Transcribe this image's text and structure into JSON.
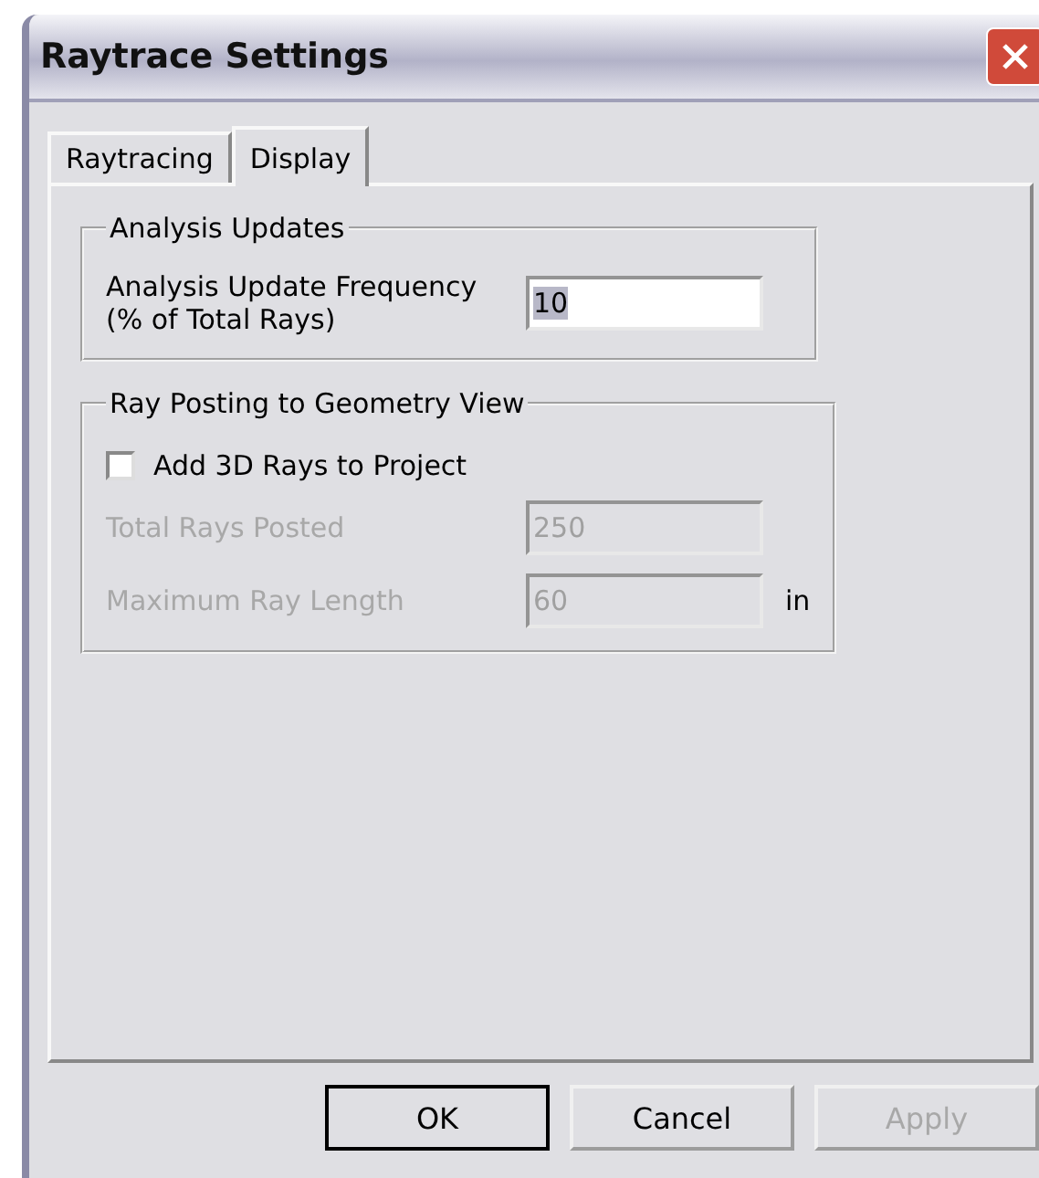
{
  "window": {
    "title": "Raytrace Settings"
  },
  "tabs": [
    {
      "label": "Raytracing",
      "selected": false
    },
    {
      "label": "Display",
      "selected": true
    }
  ],
  "groups": [
    {
      "title": "Analysis Updates",
      "rows": [
        {
          "kind": "field",
          "label": "Analysis Update Frequency\n(% of Total Rays)",
          "value": "10",
          "disabled": false,
          "text_selected": true
        }
      ]
    },
    {
      "title": "Ray Posting to Geometry View",
      "rows": [
        {
          "kind": "checkbox",
          "label": "Add 3D Rays to Project",
          "checked": false
        },
        {
          "kind": "field",
          "label": "Total Rays Posted",
          "value": "250",
          "disabled": true,
          "text_selected": false
        },
        {
          "kind": "field",
          "label": "Maximum Ray Length",
          "value": "60",
          "disabled": true,
          "text_selected": false,
          "unit": "in"
        }
      ]
    }
  ],
  "buttons": [
    {
      "label": "OK",
      "default": true,
      "disabled": false
    },
    {
      "label": "Cancel",
      "default": false,
      "disabled": false
    },
    {
      "label": "Apply",
      "default": false,
      "disabled": true
    }
  ]
}
